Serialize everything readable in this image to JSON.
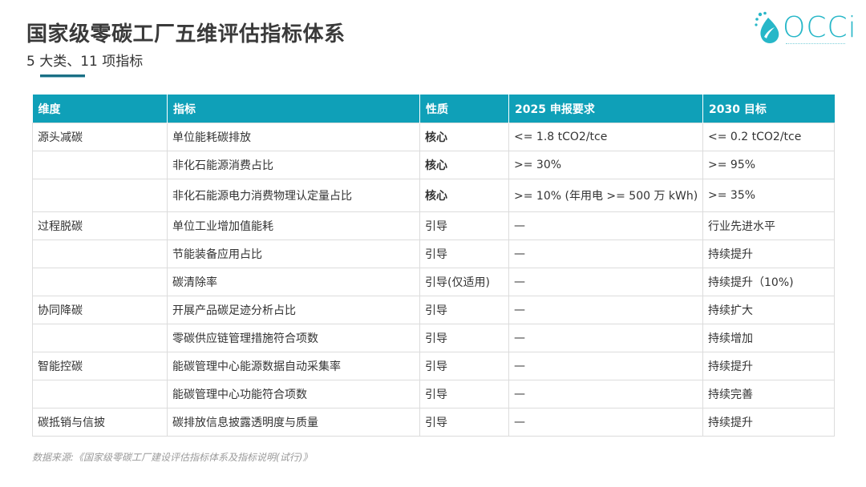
{
  "title": "国家级零碳工厂五维评估指标体系",
  "subtitle": "5 大类、11 项指标",
  "logo": {
    "text": "OCCi",
    "icon": "leaf-drop-icon"
  },
  "table": {
    "headers": [
      "维度",
      "指标",
      "性质",
      "2025 申报要求",
      "2030 目标"
    ],
    "rows": [
      [
        "源头减碳",
        "单位能耗碳排放",
        "核心",
        "<= 1.8 tCO2/tce",
        "<= 0.2 tCO2/tce"
      ],
      [
        "",
        "非化石能源消费占比",
        "核心",
        ">= 30%",
        ">= 95%"
      ],
      [
        "",
        "非化石能源电力消费物理认定量占比",
        "核心",
        ">= 10% (年用电 >= 500 万 kWh)",
        ">= 35%"
      ],
      [
        "过程脱碳",
        "单位工业增加值能耗",
        "引导",
        "—",
        "行业先进水平"
      ],
      [
        "",
        "节能装备应用占比",
        "引导",
        "—",
        "持续提升"
      ],
      [
        "",
        "碳清除率",
        "引导(仅适用)",
        "—",
        "持续提升（10%)"
      ],
      [
        "协同降碳",
        "开展产品碳足迹分析占比",
        "引导",
        "—",
        "持续扩大"
      ],
      [
        "",
        "零碳供应链管理措施符合项数",
        "引导",
        "—",
        "持续增加"
      ],
      [
        "智能控碳",
        "能碳管理中心能源数据自动采集率",
        "引导",
        "—",
        "持续提升"
      ],
      [
        "",
        "能碳管理中心功能符合项数",
        "引导",
        "—",
        "持续完善"
      ],
      [
        "碳抵销与信披",
        "碳排放信息披露透明度与质量",
        "引导",
        "—",
        "持续提升"
      ]
    ]
  },
  "source": "数据来源:《国家级零碳工厂建设评估指标体系及指标说明(试行)》",
  "colors": {
    "header_bg": "#0fa0b8",
    "accent": "#1a6f85",
    "logo": "#27b7c8"
  }
}
